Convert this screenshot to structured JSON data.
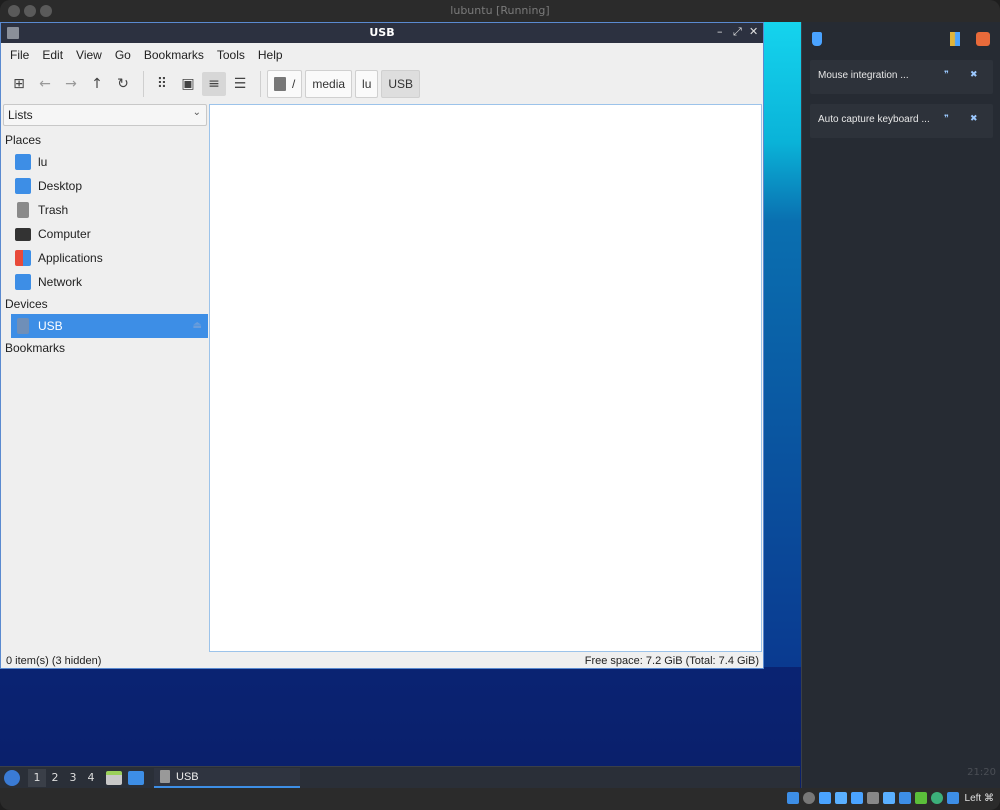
{
  "host": {
    "title": "lubuntu [Running]",
    "status_key_label": "Left ⌘"
  },
  "window": {
    "title": "USB",
    "minimize_glyph": "–",
    "maximize_glyph": "⤢",
    "close_glyph": "✕"
  },
  "menu": [
    "File",
    "Edit",
    "View",
    "Go",
    "Bookmarks",
    "Tools",
    "Help"
  ],
  "toolbar": {
    "new_tab_glyph": "⊞",
    "back_glyph": "←",
    "forward_glyph": "→",
    "up_glyph": "↑",
    "reload_glyph": "↻",
    "icon_view_glyph": "⠿",
    "thumb_view_glyph": "▣",
    "compact_view_glyph": "≡",
    "detail_view_glyph": "☰"
  },
  "breadcrumb": [
    "/",
    "media",
    "lu",
    "USB"
  ],
  "sidebar": {
    "mode": "Lists",
    "chevron": "⌄",
    "sections": {
      "places": "Places",
      "devices": "Devices",
      "bookmarks": "Bookmarks"
    },
    "places": [
      {
        "label": "lu",
        "icon": "home-folder-icon",
        "color": "#3d8ee6"
      },
      {
        "label": "Desktop",
        "icon": "desktop-icon",
        "color": "#3d8ee6"
      },
      {
        "label": "Trash",
        "icon": "trash-icon",
        "color": "#8a8a8a"
      },
      {
        "label": "Computer",
        "icon": "computer-icon",
        "color": "#333333"
      },
      {
        "label": "Applications",
        "icon": "applications-icon",
        "color": "#e84a3a"
      },
      {
        "label": "Network",
        "icon": "network-folder-icon",
        "color": "#3d8ee6"
      }
    ],
    "devices": [
      {
        "label": "USB",
        "selected": true,
        "eject_glyph": "⏏"
      }
    ]
  },
  "status": {
    "left": "0 item(s) (3 hidden)",
    "right": "Free space: 7.2 GiB (Total: 7.4 GiB)"
  },
  "notifications": {
    "items": [
      {
        "text": "Mouse integration ...",
        "info_glyph": "❞",
        "close_glyph": "✖"
      },
      {
        "text": "Auto capture keyboard ...",
        "info_glyph": "❞",
        "close_glyph": "✖"
      }
    ],
    "clock": "21:20"
  },
  "panel": {
    "desktops": [
      "1",
      "2",
      "3",
      "4"
    ],
    "active_desktop": "1",
    "task_label": "USB"
  },
  "colors": {
    "accent": "#3d8ee6",
    "title_bar": "#2c3140",
    "desktop_bg": "#0a2a7a"
  }
}
